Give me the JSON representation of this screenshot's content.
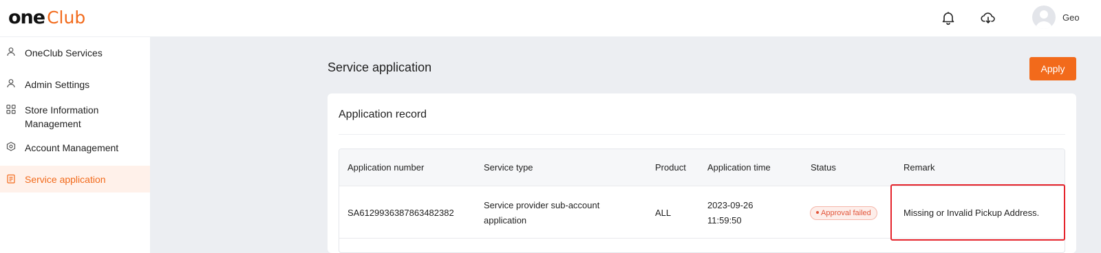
{
  "header": {
    "logo_one": "one",
    "logo_club": "Club",
    "user_name": "Geo",
    "icons": [
      "bell-icon",
      "cloud-download-icon",
      "avatar"
    ]
  },
  "sidebar": {
    "items": [
      {
        "label": "OneClub Services",
        "icon": "user-icon"
      },
      {
        "label": "Admin Settings",
        "icon": "user-icon"
      },
      {
        "label": "Store Information Management",
        "icon": "grid-icon"
      },
      {
        "label": "Account Management",
        "icon": "hexagon-icon"
      },
      {
        "label": "Service application",
        "icon": "clipboard-icon",
        "active": true
      }
    ]
  },
  "main": {
    "title": "Service application",
    "apply_label": "Apply",
    "card_title": "Application record",
    "table": {
      "headers": [
        "Application number",
        "Service type",
        "Product",
        "Application time",
        "Status",
        "Remark"
      ],
      "rows": [
        {
          "number": "SA6129936387863482382",
          "service_type_line1": "Service provider sub-account",
          "service_type_line2": "application",
          "product": "ALL",
          "time_date": "2023-09-26",
          "time_clock": "11:59:50",
          "status": "Approval failed",
          "remark": "Missing or Invalid Pickup Address."
        }
      ]
    }
  },
  "colors": {
    "accent": "#f26a1b",
    "status_failed": "#e2553a",
    "highlight": "#e5232b",
    "background": "#eceef2"
  }
}
